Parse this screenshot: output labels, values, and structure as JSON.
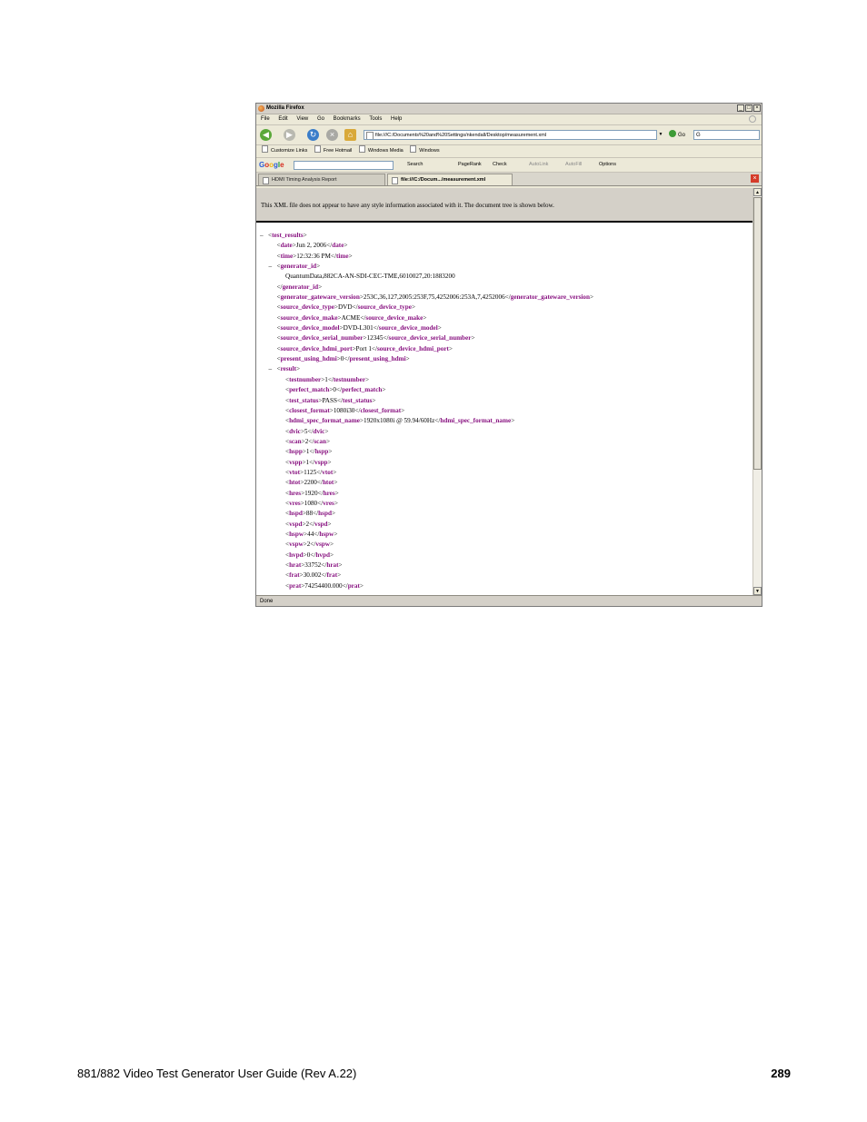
{
  "window": {
    "title": "Mozilla Firefox",
    "controls": [
      "_",
      "□",
      "×"
    ]
  },
  "menu": [
    "File",
    "Edit",
    "View",
    "Go",
    "Bookmarks",
    "Tools",
    "Help"
  ],
  "nav": {
    "url": "file:///C:/Documents%20and%20Settings/nkendall/Desktop/measurement.xml",
    "go_label": "Go",
    "search_value": "G"
  },
  "bookmarks": [
    "Customize Links",
    "Free Hotmail",
    "Windows Media",
    "Windows"
  ],
  "google_toolbar": {
    "logo": "Google",
    "search_label": "Search",
    "pagerank_label": "PageRank",
    "check_label": "Check",
    "autolink_label": "AutoLink",
    "autofill_label": "AutoFill",
    "options_label": "Options"
  },
  "tabs": [
    {
      "label": "HDMI Timing Analysis Report"
    },
    {
      "label": "file:///C:/Docum.../measurement.xml"
    }
  ],
  "info_message": "This XML file does not appear to have any style information associated with it. The document tree is shown below.",
  "xml_lines": [
    {
      "marker": "–",
      "parts": [
        [
          "b",
          "<"
        ],
        [
          "t",
          "test_results"
        ],
        [
          "b",
          ">"
        ]
      ]
    },
    {
      "marker": "",
      "parts": [
        [
          "b",
          "<"
        ],
        [
          "t",
          "date"
        ],
        [
          "b",
          ">Jun 2, 2006</"
        ],
        [
          "t",
          "date"
        ],
        [
          "b",
          ">"
        ]
      ]
    },
    {
      "marker": "",
      "parts": [
        [
          "b",
          "<"
        ],
        [
          "t",
          "time"
        ],
        [
          "b",
          ">12:32:36 PM</"
        ],
        [
          "t",
          "time"
        ],
        [
          "b",
          ">"
        ]
      ]
    },
    {
      "marker": "–",
      "parts": [
        [
          "b",
          "<"
        ],
        [
          "t",
          "generator_id"
        ],
        [
          "b",
          ">"
        ]
      ]
    },
    {
      "marker": "",
      "parts": [
        [
          "b",
          "QuantumData,882CA-AN-SDI-CEC-TME,6010027,20:1883200"
        ]
      ]
    },
    {
      "marker": "",
      "parts": [
        [
          "b",
          "</"
        ],
        [
          "t",
          "generator_id"
        ],
        [
          "b",
          ">"
        ]
      ]
    },
    {
      "marker": "",
      "parts": [
        [
          "b",
          "<"
        ],
        [
          "t",
          "generator_gateware_version"
        ],
        [
          "b",
          ">253C,36,127,2005:253F,75,4252006:253A,7,4252006</"
        ],
        [
          "t",
          "generator_gateware_version"
        ],
        [
          "b",
          ">"
        ]
      ]
    },
    {
      "marker": "",
      "parts": [
        [
          "b",
          "<"
        ],
        [
          "t",
          "source_device_type"
        ],
        [
          "b",
          ">DVD</"
        ],
        [
          "t",
          "source_device_type"
        ],
        [
          "b",
          ">"
        ]
      ]
    },
    {
      "marker": "",
      "parts": [
        [
          "b",
          "<"
        ],
        [
          "t",
          "source_device_make"
        ],
        [
          "b",
          ">ACME</"
        ],
        [
          "t",
          "source_device_make"
        ],
        [
          "b",
          ">"
        ]
      ]
    },
    {
      "marker": "",
      "parts": [
        [
          "b",
          "<"
        ],
        [
          "t",
          "source_device_model"
        ],
        [
          "b",
          ">DVD-L301</"
        ],
        [
          "t",
          "source_device_model"
        ],
        [
          "b",
          ">"
        ]
      ]
    },
    {
      "marker": "",
      "parts": [
        [
          "b",
          "<"
        ],
        [
          "t",
          "source_device_serial_number"
        ],
        [
          "b",
          ">12345</"
        ],
        [
          "t",
          "source_device_serial_number"
        ],
        [
          "b",
          ">"
        ]
      ]
    },
    {
      "marker": "",
      "parts": [
        [
          "b",
          "<"
        ],
        [
          "t",
          "source_device_hdmi_port"
        ],
        [
          "b",
          ">Port 1</"
        ],
        [
          "t",
          "source_device_hdmi_port"
        ],
        [
          "b",
          ">"
        ]
      ]
    },
    {
      "marker": "",
      "parts": [
        [
          "b",
          "<"
        ],
        [
          "t",
          "present_using_hdmi"
        ],
        [
          "b",
          ">0</"
        ],
        [
          "t",
          "present_using_hdmi"
        ],
        [
          "b",
          ">"
        ]
      ]
    },
    {
      "marker": "–",
      "parts": [
        [
          "b",
          "<"
        ],
        [
          "t",
          "result"
        ],
        [
          "b",
          ">"
        ]
      ]
    },
    {
      "marker": "",
      "parts": [
        [
          "b",
          "<"
        ],
        [
          "t",
          "testnumber"
        ],
        [
          "b",
          ">1</"
        ],
        [
          "t",
          "testnumber"
        ],
        [
          "b",
          ">"
        ]
      ]
    },
    {
      "marker": "",
      "parts": [
        [
          "b",
          "<"
        ],
        [
          "t",
          "perfect_match"
        ],
        [
          "b",
          ">0</"
        ],
        [
          "t",
          "perfect_match"
        ],
        [
          "b",
          ">"
        ]
      ]
    },
    {
      "marker": "",
      "parts": [
        [
          "b",
          "<"
        ],
        [
          "t",
          "test_status"
        ],
        [
          "b",
          ">PASS</"
        ],
        [
          "t",
          "test_status"
        ],
        [
          "b",
          ">"
        ]
      ]
    },
    {
      "marker": "",
      "parts": [
        [
          "b",
          "<"
        ],
        [
          "t",
          "closest_format"
        ],
        [
          "b",
          ">1080i30</"
        ],
        [
          "t",
          "closest_format"
        ],
        [
          "b",
          ">"
        ]
      ]
    },
    {
      "marker": "",
      "parts": [
        [
          "b",
          "<"
        ],
        [
          "t",
          "hdmi_spec_format_name"
        ],
        [
          "b",
          ">1920x1080i @ 59.94/60Hz</"
        ],
        [
          "t",
          "hdmi_spec_format_name"
        ],
        [
          "b",
          ">"
        ]
      ]
    },
    {
      "marker": "",
      "parts": [
        [
          "b",
          "<"
        ],
        [
          "t",
          "dvic"
        ],
        [
          "b",
          ">5</"
        ],
        [
          "t",
          "dvic"
        ],
        [
          "b",
          ">"
        ]
      ]
    },
    {
      "marker": "",
      "parts": [
        [
          "b",
          "<"
        ],
        [
          "t",
          "scan"
        ],
        [
          "b",
          ">2</"
        ],
        [
          "t",
          "scan"
        ],
        [
          "b",
          ">"
        ]
      ]
    },
    {
      "marker": "",
      "parts": [
        [
          "b",
          "<"
        ],
        [
          "t",
          "hspp"
        ],
        [
          "b",
          ">1</"
        ],
        [
          "t",
          "hspp"
        ],
        [
          "b",
          ">"
        ]
      ]
    },
    {
      "marker": "",
      "parts": [
        [
          "b",
          "<"
        ],
        [
          "t",
          "vspp"
        ],
        [
          "b",
          ">1</"
        ],
        [
          "t",
          "vspp"
        ],
        [
          "b",
          ">"
        ]
      ]
    },
    {
      "marker": "",
      "parts": [
        [
          "b",
          "<"
        ],
        [
          "t",
          "vtot"
        ],
        [
          "b",
          ">1125</"
        ],
        [
          "t",
          "vtot"
        ],
        [
          "b",
          ">"
        ]
      ]
    },
    {
      "marker": "",
      "parts": [
        [
          "b",
          "<"
        ],
        [
          "t",
          "htot"
        ],
        [
          "b",
          ">2200</"
        ],
        [
          "t",
          "htot"
        ],
        [
          "b",
          ">"
        ]
      ]
    },
    {
      "marker": "",
      "parts": [
        [
          "b",
          "<"
        ],
        [
          "t",
          "hres"
        ],
        [
          "b",
          ">1920</"
        ],
        [
          "t",
          "hres"
        ],
        [
          "b",
          ">"
        ]
      ]
    },
    {
      "marker": "",
      "parts": [
        [
          "b",
          "<"
        ],
        [
          "t",
          "vres"
        ],
        [
          "b",
          ">1080</"
        ],
        [
          "t",
          "vres"
        ],
        [
          "b",
          ">"
        ]
      ]
    },
    {
      "marker": "",
      "parts": [
        [
          "b",
          "<"
        ],
        [
          "t",
          "hspd"
        ],
        [
          "b",
          ">88</"
        ],
        [
          "t",
          "hspd"
        ],
        [
          "b",
          ">"
        ]
      ]
    },
    {
      "marker": "",
      "parts": [
        [
          "b",
          "<"
        ],
        [
          "t",
          "vspd"
        ],
        [
          "b",
          ">2</"
        ],
        [
          "t",
          "vspd"
        ],
        [
          "b",
          ">"
        ]
      ]
    },
    {
      "marker": "",
      "parts": [
        [
          "b",
          "<"
        ],
        [
          "t",
          "hspw"
        ],
        [
          "b",
          ">44</"
        ],
        [
          "t",
          "hspw"
        ],
        [
          "b",
          ">"
        ]
      ]
    },
    {
      "marker": "",
      "parts": [
        [
          "b",
          "<"
        ],
        [
          "t",
          "vspw"
        ],
        [
          "b",
          ">2</"
        ],
        [
          "t",
          "vspw"
        ],
        [
          "b",
          ">"
        ]
      ]
    },
    {
      "marker": "",
      "parts": [
        [
          "b",
          "<"
        ],
        [
          "t",
          "hvpd"
        ],
        [
          "b",
          ">0</"
        ],
        [
          "t",
          "hvpd"
        ],
        [
          "b",
          ">"
        ]
      ]
    },
    {
      "marker": "",
      "parts": [
        [
          "b",
          "<"
        ],
        [
          "t",
          "hrat"
        ],
        [
          "b",
          ">33752</"
        ],
        [
          "t",
          "hrat"
        ],
        [
          "b",
          ">"
        ]
      ]
    },
    {
      "marker": "",
      "parts": [
        [
          "b",
          "<"
        ],
        [
          "t",
          "frat"
        ],
        [
          "b",
          ">30.002</"
        ],
        [
          "t",
          "frat"
        ],
        [
          "b",
          ">"
        ]
      ]
    },
    {
      "marker": "",
      "parts": [
        [
          "b",
          "<"
        ],
        [
          "t",
          "prat"
        ],
        [
          "b",
          ">74254400.000</"
        ],
        [
          "t",
          "prat"
        ],
        [
          "b",
          ">"
        ]
      ]
    }
  ],
  "xml_indent": [
    0,
    1,
    1,
    1,
    2,
    1,
    1,
    1,
    1,
    1,
    1,
    1,
    1,
    1,
    2,
    2,
    2,
    2,
    2,
    2,
    2,
    2,
    2,
    2,
    2,
    2,
    2,
    2,
    2,
    2,
    2,
    2,
    2,
    2,
    2
  ],
  "status": "Done",
  "footer": {
    "left": "881/882 Video Test Generator User Guide (Rev A.22)",
    "right": "289"
  },
  "colors": {
    "xml_tag": "#881280",
    "window_chrome": "#ece9d8"
  }
}
